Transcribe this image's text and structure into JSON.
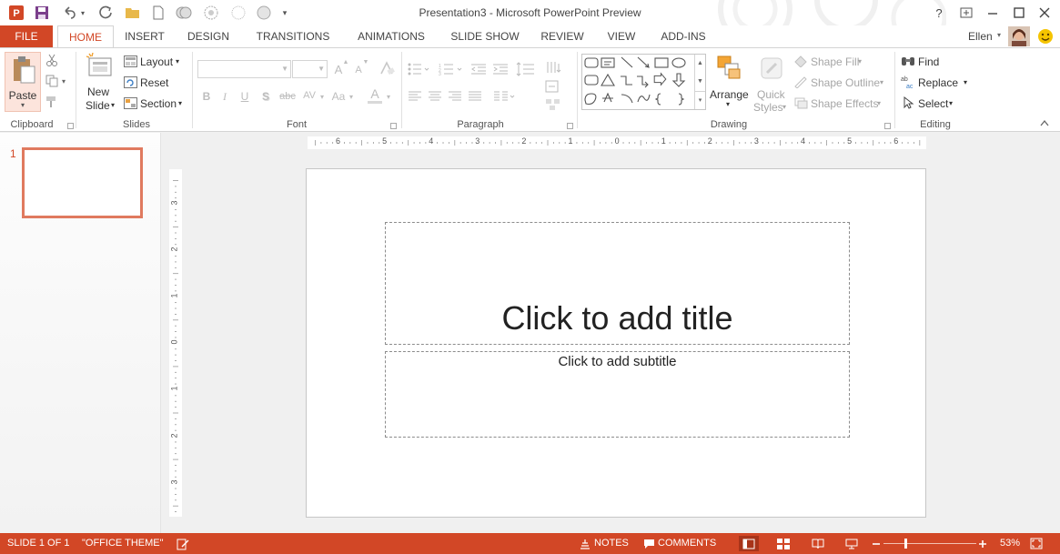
{
  "window": {
    "title": "Presentation3 - Microsoft PowerPoint Preview",
    "app_icon_label": "P",
    "help_label": "?",
    "qat_customize_label": "▾"
  },
  "tabs": [
    "FILE",
    "HOME",
    "INSERT",
    "DESIGN",
    "TRANSITIONS",
    "ANIMATIONS",
    "SLIDE SHOW",
    "REVIEW",
    "VIEW",
    "ADD-INS"
  ],
  "active_tab": "HOME",
  "user": {
    "name": "Ellen"
  },
  "ribbon": {
    "clipboard": {
      "label": "Clipboard",
      "paste": "Paste"
    },
    "slides": {
      "label": "Slides",
      "new_slide_line1": "New",
      "new_slide_line2": "Slide",
      "layout": "Layout",
      "reset": "Reset",
      "section": "Section"
    },
    "font": {
      "label": "Font",
      "bold": "B",
      "italic": "I",
      "underline": "U",
      "shadow": "S",
      "strike": "abc",
      "spacing": "AV",
      "change_case": "Aa",
      "font_color": "A",
      "grow": "A",
      "shrink": "A"
    },
    "paragraph": {
      "label": "Paragraph"
    },
    "drawing": {
      "label": "Drawing",
      "arrange": "Arrange",
      "quick_styles_line1": "Quick",
      "quick_styles_line2": "Styles",
      "shape_fill": "Shape Fill",
      "shape_outline": "Shape Outline",
      "shape_effects": "Shape Effects"
    },
    "editing": {
      "label": "Editing",
      "find": "Find",
      "replace": "Replace",
      "select": "Select"
    }
  },
  "thumbnails": [
    {
      "number": "1"
    }
  ],
  "rulers": {
    "horizontal": [
      "6",
      "5",
      "4",
      "3",
      "2",
      "1",
      "0",
      "1",
      "2",
      "3",
      "4",
      "5",
      "6"
    ],
    "vertical": [
      "3",
      "2",
      "1",
      "0",
      "1",
      "2",
      "3"
    ]
  },
  "slide": {
    "title_placeholder": "Click to add title",
    "subtitle_placeholder": "Click to add subtitle"
  },
  "status": {
    "slide_count": "SLIDE 1 OF 1",
    "theme": "\"OFFICE THEME\"",
    "notes": "NOTES",
    "comments": "COMMENTS",
    "zoom": "53%",
    "zoom_level": 0.53
  },
  "colors": {
    "accent": "#d24726",
    "slide_background": "#ffffff",
    "thumbnail_selected": "#e07a5f"
  }
}
